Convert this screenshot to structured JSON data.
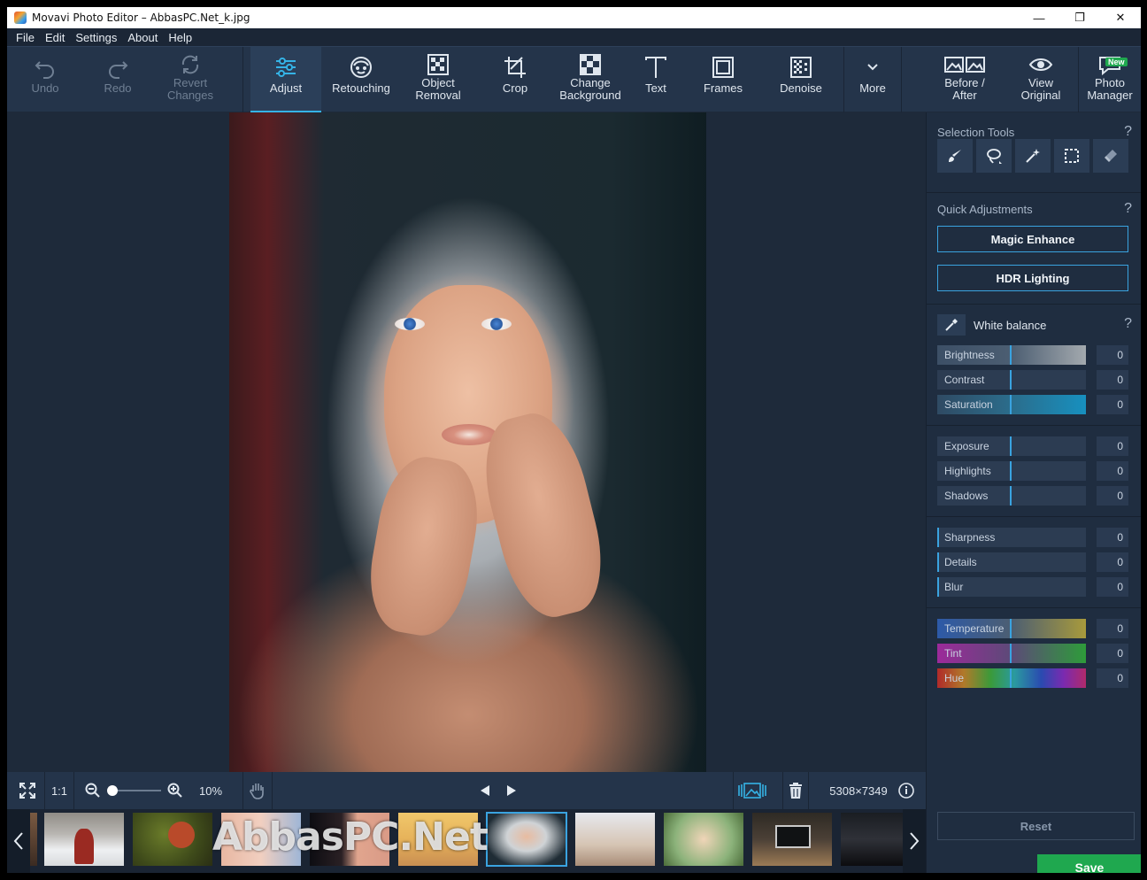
{
  "window": {
    "title": "Movavi Photo Editor – AbbasPC.Net_k.jpg",
    "minimize_glyph": "—",
    "maximize_glyph": "❐",
    "close_glyph": "✕"
  },
  "menu": [
    "File",
    "Edit",
    "Settings",
    "About",
    "Help"
  ],
  "toolbar": {
    "undo": "Undo",
    "redo": "Redo",
    "revert_line1": "Revert",
    "revert_line2": "Changes",
    "adjust": "Adjust",
    "retouching": "Retouching",
    "object_removal_line1": "Object",
    "object_removal_line2": "Removal",
    "crop": "Crop",
    "change_bg_line1": "Change",
    "change_bg_line2": "Background",
    "text": "Text",
    "frames": "Frames",
    "denoise": "Denoise",
    "more": "More",
    "before_after_line1": "Before /",
    "before_after_line2": "After",
    "view_original_line1": "View",
    "view_original_line2": "Original",
    "photo_manager_line1": "Photo",
    "photo_manager_line2": "Manager",
    "new_badge": "New"
  },
  "viewbar": {
    "one_to_one": "1:1",
    "zoom_percent": "10%",
    "dimensions": "5308×7349",
    "zoom_level": 0.1
  },
  "filmstrip": {
    "watermark": "AbbasPC.Net",
    "selected_index": 5
  },
  "panel": {
    "selection_tools_title": "Selection Tools",
    "quick_adjustments_title": "Quick Adjustments",
    "magic_enhance": "Magic Enhance",
    "hdr_lighting": "HDR Lighting",
    "white_balance": "White balance",
    "help_glyph": "?",
    "sliders": [
      {
        "label": "Brightness",
        "value": "0"
      },
      {
        "label": "Contrast",
        "value": "0"
      },
      {
        "label": "Saturation",
        "value": "0"
      },
      {
        "label": "Exposure",
        "value": "0"
      },
      {
        "label": "Highlights",
        "value": "0"
      },
      {
        "label": "Shadows",
        "value": "0"
      },
      {
        "label": "Sharpness",
        "value": "0"
      },
      {
        "label": "Details",
        "value": "0"
      },
      {
        "label": "Blur",
        "value": "0"
      },
      {
        "label": "Temperature",
        "value": "0"
      },
      {
        "label": "Tint",
        "value": "0"
      },
      {
        "label": "Hue",
        "value": "0"
      }
    ],
    "reset": "Reset",
    "save": "Save"
  },
  "colors": {
    "accent": "#3aa3e0",
    "save_green": "#1fa84f",
    "window_bg": "#1e2a3a",
    "toolbar_bg": "#24344a"
  }
}
